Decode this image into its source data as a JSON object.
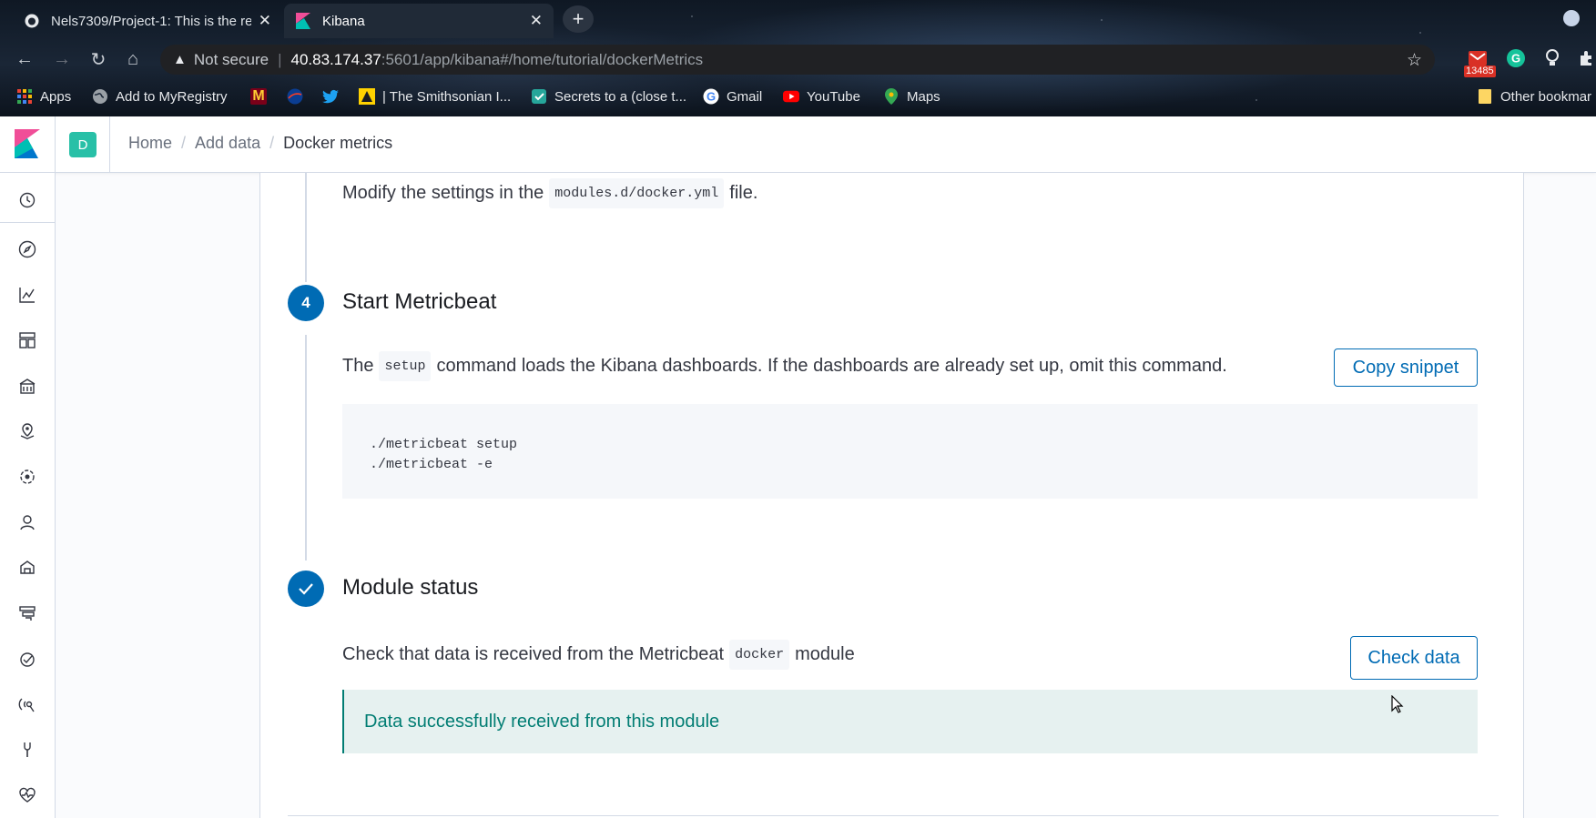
{
  "browser": {
    "tabs": [
      {
        "title": "Nels7309/Project-1: This is the re",
        "icon": "github-icon",
        "active": false
      },
      {
        "title": "Kibana",
        "icon": "kibana-icon",
        "active": true
      }
    ],
    "address": {
      "security_label": "Not secure",
      "host": "40.83.174.37",
      "rest": ":5601/app/kibana#/home/tutorial/dockerMetrics"
    },
    "extension_badge": "13485",
    "bookmarks": [
      {
        "label": "Apps",
        "icon": "apps-grid-icon"
      },
      {
        "label": "Add to MyRegistry",
        "icon": "globe-icon"
      },
      {
        "label": "",
        "icon": "minnesota-m-icon"
      },
      {
        "label": "",
        "icon": "nasa-icon"
      },
      {
        "label": "",
        "icon": "twitter-icon"
      },
      {
        "label": "| The Smithsonian I...",
        "icon": "smithsonian-icon"
      },
      {
        "label": "Secrets to a (close t...",
        "icon": "bookmark-site-icon"
      },
      {
        "label": "Gmail",
        "icon": "google-icon"
      },
      {
        "label": "YouTube",
        "icon": "youtube-icon"
      },
      {
        "label": "Maps",
        "icon": "maps-icon"
      }
    ],
    "other_bookmarks": "Other bookmar"
  },
  "kibana": {
    "space_initial": "D",
    "breadcrumbs": [
      "Home",
      "Add data",
      "Docker metrics"
    ],
    "sidenav_icons": [
      "recently-viewed-icon",
      "discover-icon",
      "visualize-icon",
      "dashboard-icon",
      "canvas-icon",
      "maps-icon",
      "ml-icon",
      "metrics-icon",
      "logs-icon",
      "apm-icon",
      "uptime-icon",
      "siem-icon",
      "dev-tools-icon",
      "stack-monitoring-icon"
    ]
  },
  "steps": {
    "modify": {
      "prefix": "Modify the settings in the",
      "code": "modules.d/docker.yml",
      "suffix": "file."
    },
    "start": {
      "number": "4",
      "title": "Start Metricbeat",
      "prefix": "The",
      "code": "setup",
      "suffix": "command loads the Kibana dashboards. If the dashboards are already set up, omit this command.",
      "copy_button": "Copy snippet",
      "code_lines": [
        "./metricbeat setup",
        "./metricbeat -e"
      ]
    },
    "status": {
      "title": "Module status",
      "prefix": "Check that data is received from the Metricbeat",
      "code": "docker",
      "suffix": "module",
      "check_button": "Check data",
      "success": "Data successfully received from this module"
    }
  }
}
